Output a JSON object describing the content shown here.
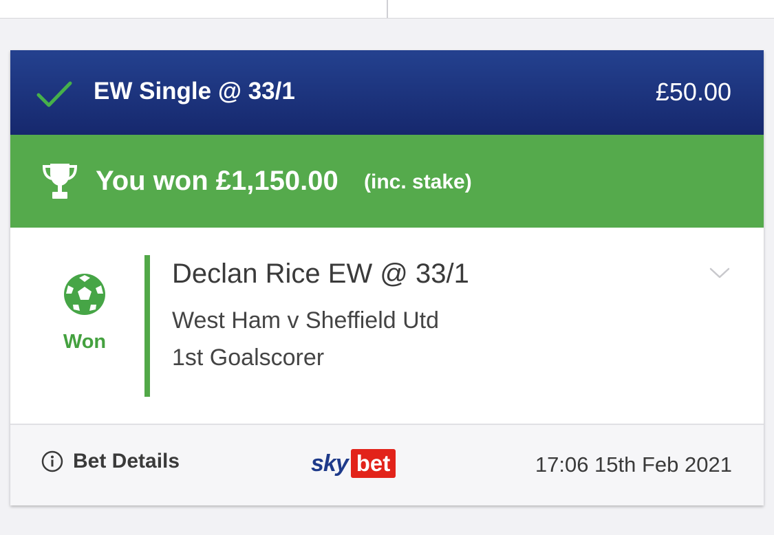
{
  "header": {
    "bet_title": "EW Single @ 33/1",
    "stake": "£50.00"
  },
  "win_banner": {
    "won_text": "You won £1,150.00",
    "stake_note": "(inc. stake)"
  },
  "selection": {
    "status": "Won",
    "name": "Declan Rice EW @ 33/1",
    "event": "West Ham v Sheffield Utd",
    "market": "1st Goalscorer"
  },
  "footer": {
    "bet_details_label": "Bet Details",
    "brand_part1": "sky",
    "brand_part2": "bet",
    "timestamp": "17:06 15th Feb 2021"
  },
  "icons": {
    "status_check": "check-icon",
    "trophy": "trophy-icon",
    "sport": "football-icon",
    "expand": "chevron-down-icon",
    "info": "info-icon"
  },
  "colors": {
    "header_blue": "#1c3580",
    "win_green": "#55aa4c",
    "status_green": "#44a13f",
    "brand_red": "#e2231a"
  }
}
